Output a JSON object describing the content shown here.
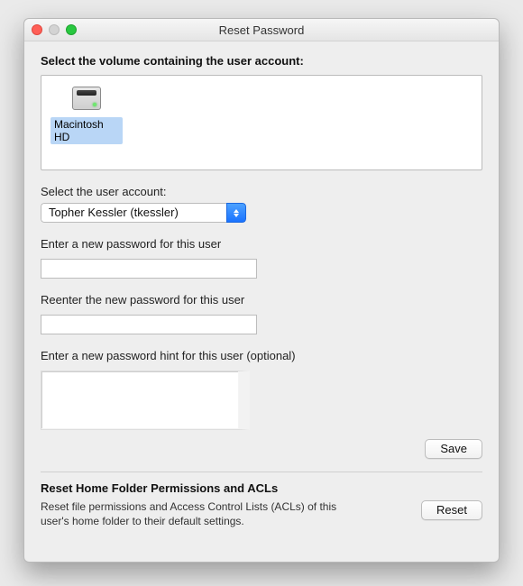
{
  "window": {
    "title": "Reset Password"
  },
  "volume_section": {
    "heading": "Select the volume containing the user account:",
    "items": [
      {
        "label": "Macintosh HD",
        "selected": true,
        "icon": "internal-hd-icon"
      }
    ]
  },
  "user_section": {
    "label": "Select the user account:",
    "selected": "Topher Kessler (tkessler)"
  },
  "password_section": {
    "new_label": "Enter a new password for this user",
    "new_value": "",
    "reenter_label": "Reenter the new password for this user",
    "reenter_value": "",
    "hint_label": "Enter a new password hint for this user (optional)",
    "hint_value": "",
    "save_button": "Save"
  },
  "acl_section": {
    "heading": "Reset Home Folder Permissions and ACLs",
    "description": "Reset file permissions and Access Control Lists (ACLs) of this user's home folder to their default settings.",
    "reset_button": "Reset"
  },
  "colors": {
    "accent_blue": "#1a73ff",
    "selection_bg": "#b9d6f6"
  }
}
